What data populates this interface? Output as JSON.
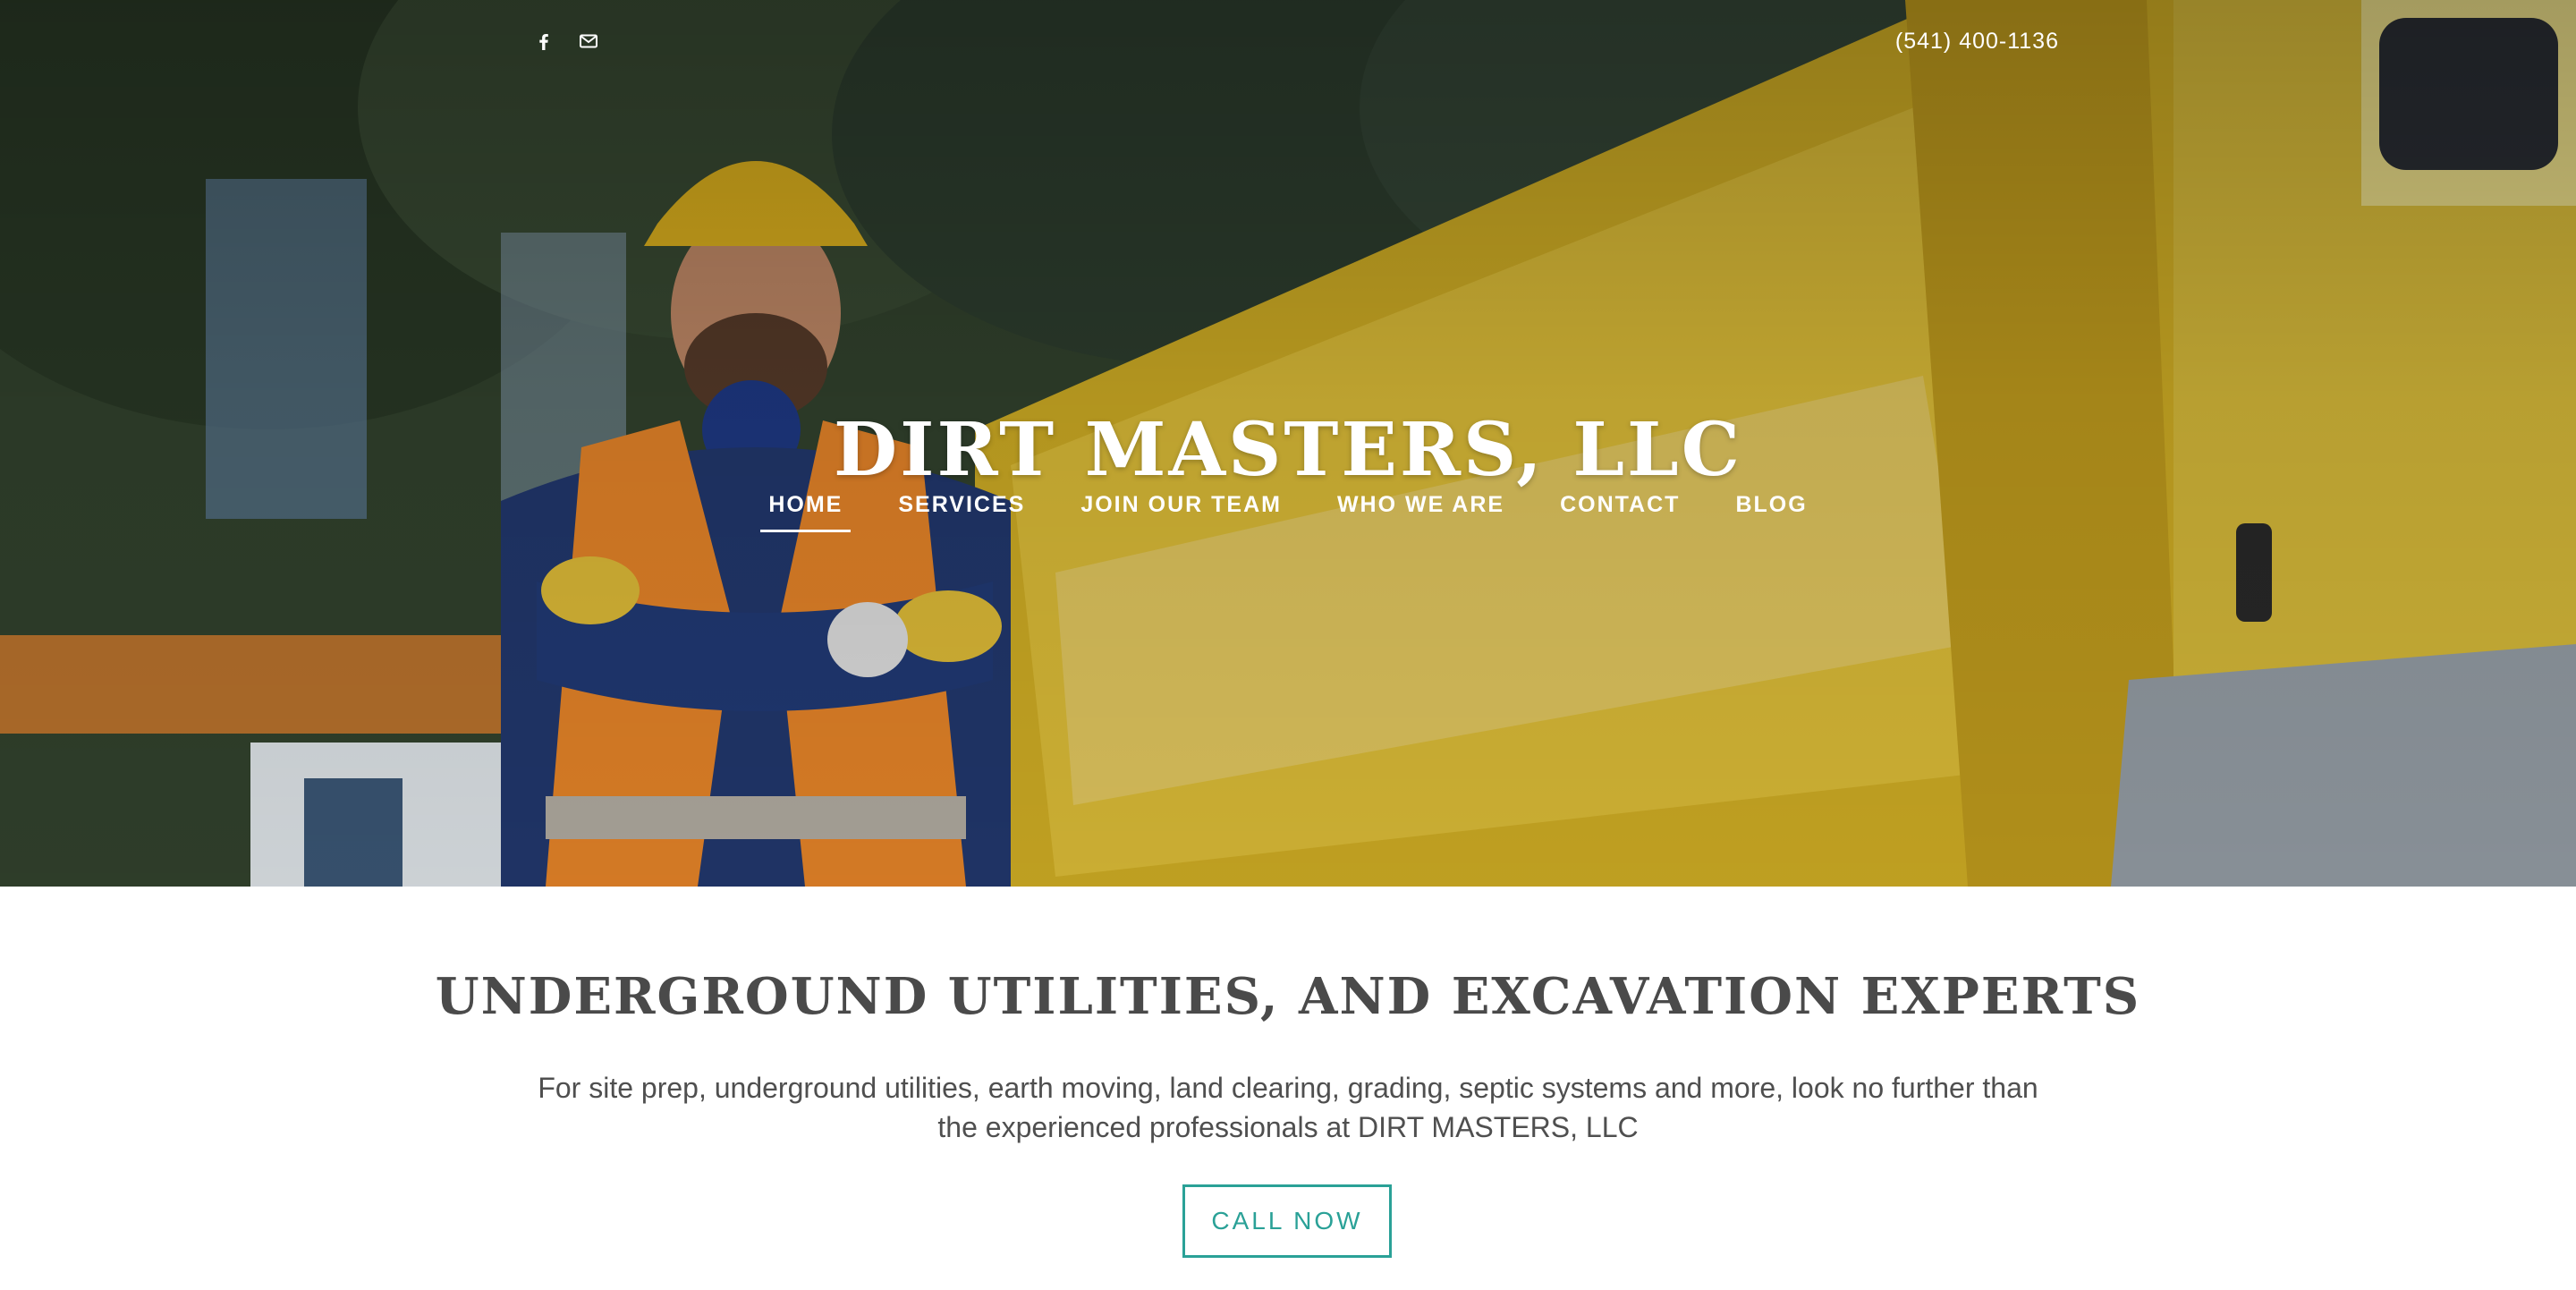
{
  "header": {
    "social_icons": [
      "facebook-icon",
      "email-icon"
    ],
    "phone": "(541) 400-1136"
  },
  "hero": {
    "site_title": "DIRT MASTERS, LLC",
    "nav": [
      {
        "label": "HOME",
        "active": true
      },
      {
        "label": "SERVICES",
        "active": false
      },
      {
        "label": "JOIN OUR TEAM",
        "active": false
      },
      {
        "label": "WHO WE ARE",
        "active": false
      },
      {
        "label": "CONTACT",
        "active": false
      },
      {
        "label": "BLOG",
        "active": false
      }
    ]
  },
  "main": {
    "headline": "UNDERGROUND UTILITIES, AND EXCAVATION EXPERTS",
    "description": "For site prep, underground utilities, earth moving, land clearing, grading, septic systems and more, look no further than the experienced professionals at DIRT MASTERS, LLC",
    "cta_label": "CALL NOW"
  },
  "colors": {
    "accent": "#2aa197",
    "heading": "#4a4a4a",
    "body_text": "#4f4f4f",
    "truck_yellow": "#e9c62a",
    "vest_orange": "#f0892a"
  }
}
